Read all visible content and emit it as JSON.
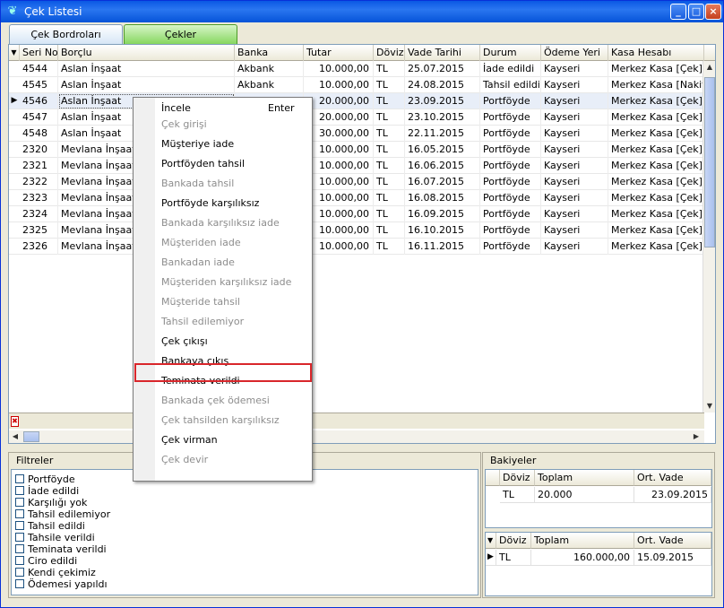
{
  "window": {
    "title": "Çek Listesi",
    "icon": "butterfly-icon"
  },
  "tabs": [
    {
      "label": "Çek Bordroları"
    },
    {
      "label": "Çekler"
    }
  ],
  "grid": {
    "columns": [
      "Seri No",
      "Borçlu",
      "Banka",
      "Tutar",
      "Döviz",
      "Vade Tarihi",
      "Durum",
      "Ödeme Yeri",
      "Kasa Hesabı"
    ],
    "rows": [
      [
        "4544",
        "Aslan İnşaat",
        "Akbank",
        "10.000,00",
        "TL",
        "25.07.2015",
        "İade edildi",
        "Kayseri",
        "Merkez Kasa [Çek]"
      ],
      [
        "4545",
        "Aslan İnşaat",
        "Akbank",
        "10.000,00",
        "TL",
        "24.08.2015",
        "Tahsil edildi",
        "Kayseri",
        "Merkez Kasa [Nakit]"
      ],
      [
        "4546",
        "Aslan İnşaat",
        "",
        "20.000,00",
        "TL",
        "23.09.2015",
        "Portföyde",
        "Kayseri",
        "Merkez Kasa [Çek]"
      ],
      [
        "4547",
        "Aslan İnşaat",
        "",
        "20.000,00",
        "TL",
        "23.10.2015",
        "Portföyde",
        "Kayseri",
        "Merkez Kasa [Çek]"
      ],
      [
        "4548",
        "Aslan İnşaat",
        "",
        "30.000,00",
        "TL",
        "22.11.2015",
        "Portföyde",
        "Kayseri",
        "Merkez Kasa [Çek]"
      ],
      [
        "2320",
        "Mevlana  İnşaat",
        "",
        "10.000,00",
        "TL",
        "16.05.2015",
        "Portföyde",
        "Kayseri",
        "Merkez Kasa [Çek]"
      ],
      [
        "2321",
        "Mevlana  İnşaat",
        "",
        "10.000,00",
        "TL",
        "16.06.2015",
        "Portföyde",
        "Kayseri",
        "Merkez Kasa [Çek]"
      ],
      [
        "2322",
        "Mevlana  İnşaat",
        "",
        "10.000,00",
        "TL",
        "16.07.2015",
        "Portföyde",
        "Kayseri",
        "Merkez Kasa [Çek]"
      ],
      [
        "2323",
        "Mevlana  İnşaat",
        "",
        "10.000,00",
        "TL",
        "16.08.2015",
        "Portföyde",
        "Kayseri",
        "Merkez Kasa [Çek]"
      ],
      [
        "2324",
        "Mevlana  İnşaat",
        "",
        "10.000,00",
        "TL",
        "16.09.2015",
        "Portföyde",
        "Kayseri",
        "Merkez Kasa [Çek]"
      ],
      [
        "2325",
        "Mevlana  İnşaat",
        "",
        "10.000,00",
        "TL",
        "16.10.2015",
        "Portföyde",
        "Kayseri",
        "Merkez Kasa [Çek]"
      ],
      [
        "2326",
        "Mevlana  İnşaat",
        "",
        "10.000,00",
        "TL",
        "16.11.2015",
        "Portföyde",
        "Kayseri",
        "Merkez Kasa [Çek]"
      ]
    ]
  },
  "context_menu": {
    "items": [
      {
        "label": "İncele",
        "shortcut": "Enter",
        "enabled": true
      },
      {
        "label": "Çek girişi",
        "enabled": false
      },
      {
        "label": "Müşteriye iade",
        "enabled": true
      },
      {
        "label": "Portföyden tahsil",
        "enabled": true
      },
      {
        "label": "Bankada tahsil",
        "enabled": false
      },
      {
        "label": "Portföyde karşılıksız",
        "enabled": true
      },
      {
        "label": "Bankada karşılıksız iade",
        "enabled": false
      },
      {
        "label": "Müşteriden iade",
        "enabled": false
      },
      {
        "label": "Bankadan iade",
        "enabled": false
      },
      {
        "label": "Müşteriden karşılıksız iade",
        "enabled": false
      },
      {
        "label": "Müşteride tahsil",
        "enabled": false
      },
      {
        "label": "Tahsil edilemiyor",
        "enabled": false
      },
      {
        "label": "Çek çıkışı",
        "enabled": true
      },
      {
        "label": "Bankaya çıkış",
        "enabled": true,
        "highlighted": true
      },
      {
        "label": "Teminata verildi",
        "enabled": true
      },
      {
        "label": "Bankada çek ödemesi",
        "enabled": false
      },
      {
        "label": "Çek tahsilden karşılıksız",
        "enabled": false
      },
      {
        "label": "Çek virman",
        "enabled": true
      },
      {
        "label": "Çek devir",
        "enabled": false
      }
    ],
    "highlight_color": "#d9262b"
  },
  "filters": {
    "title": "Filtreler",
    "items": [
      "Portföyde",
      "İade edildi",
      "Karşılığı yok",
      "Tahsil edilemiyor",
      "Tahsil edildi",
      "Tahsile verildi",
      "Teminata verildi",
      "Ciro edildi",
      "Kendi çekimiz",
      "Ödemesi yapıldı"
    ]
  },
  "balances": {
    "title": "Bakiyeler",
    "top": {
      "columns": [
        "Döviz",
        "Toplam",
        "Ort. Vade"
      ],
      "row": [
        "TL",
        "20.000",
        "23.09.2015"
      ]
    },
    "bottom": {
      "columns": [
        "Döviz",
        "Toplam",
        "Ort. Vade"
      ],
      "row": [
        "TL",
        "160.000,00",
        "15.09.2015"
      ]
    }
  },
  "title_buttons": {
    "minimize": "_",
    "maximize": "□",
    "close": "×"
  }
}
